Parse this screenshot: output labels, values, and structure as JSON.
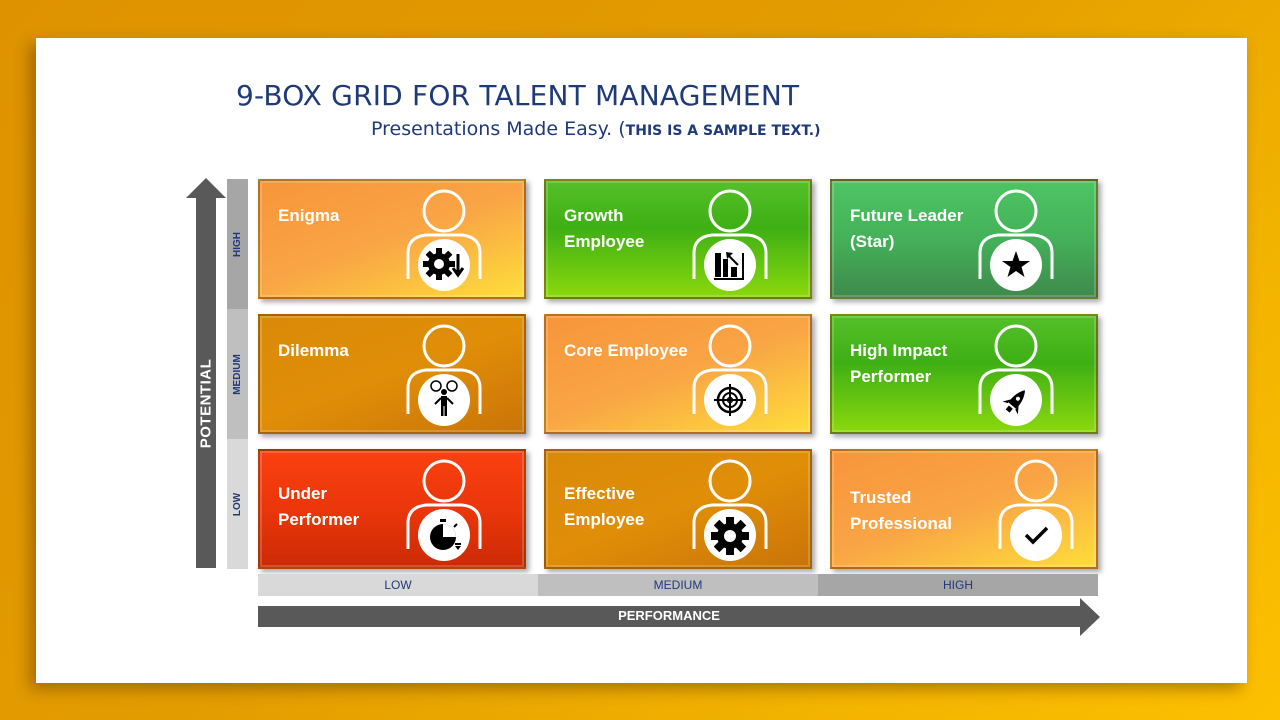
{
  "header": {
    "title": "9-BOX GRID FOR TALENT MANAGEMENT",
    "subtitle": "Presentations Made Easy. (",
    "subtitle_caps": "THIS IS A SAMPLE TEXT.)"
  },
  "axes": {
    "y_label": "POTENTIAL",
    "y_levels": [
      "HIGH",
      "MEDIUM",
      "LOW"
    ],
    "x_label": "PERFORMANCE",
    "x_levels": [
      "LOW",
      "MEDIUM",
      "HIGH"
    ],
    "axis_color": "#595959"
  },
  "boxes": [
    {
      "label": "Enigma",
      "icon": "gear-down-arrow-icon",
      "potential": "HIGH",
      "performance": "LOW",
      "color": "#f9a545"
    },
    {
      "label": "Growth Employee",
      "icon": "growth-chart-icon",
      "potential": "HIGH",
      "performance": "MEDIUM",
      "color": "#3eaf14"
    },
    {
      "label": "Future Leader (Star)",
      "icon": "star-icon",
      "potential": "HIGH",
      "performance": "HIGH",
      "color": "#44b159"
    },
    {
      "label": "Dilemma",
      "icon": "confused-person-icon",
      "potential": "MEDIUM",
      "performance": "LOW",
      "color": "#e08e08"
    },
    {
      "label": "Core Employee",
      "icon": "target-icon",
      "potential": "MEDIUM",
      "performance": "MEDIUM",
      "color": "#f9a545"
    },
    {
      "label": "High Impact Performer",
      "icon": "rocket-icon",
      "potential": "MEDIUM",
      "performance": "HIGH",
      "color": "#3eaf14"
    },
    {
      "label": "Under Performer",
      "icon": "stopwatch-icon",
      "potential": "LOW",
      "performance": "LOW",
      "color": "#e8350a"
    },
    {
      "label": "Effective Employee",
      "icon": "gear-icon",
      "potential": "LOW",
      "performance": "MEDIUM",
      "color": "#e08e08"
    },
    {
      "label": "Trusted Professional",
      "icon": "checkmark-icon",
      "potential": "LOW",
      "performance": "HIGH",
      "color": "#f9a545"
    }
  ]
}
